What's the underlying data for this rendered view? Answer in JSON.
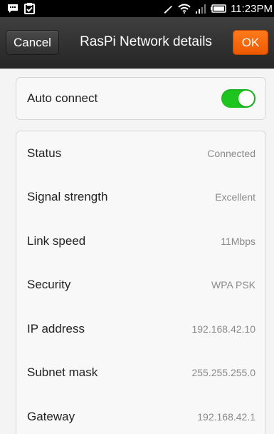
{
  "status_bar": {
    "time": "11:23PM",
    "icons": [
      "chat-bubble-icon",
      "clipboard-check-icon",
      "no-signal-icon",
      "wifi-icon",
      "cell-signal-icon",
      "battery-icon"
    ]
  },
  "action_bar": {
    "cancel_label": "Cancel",
    "title": "RasPi Network details",
    "ok_label": "OK"
  },
  "auto_connect": {
    "label": "Auto connect",
    "enabled": true
  },
  "details": [
    {
      "label": "Status",
      "value": "Connected"
    },
    {
      "label": "Signal strength",
      "value": "Excellent"
    },
    {
      "label": "Link speed",
      "value": "11Mbps"
    },
    {
      "label": "Security",
      "value": "WPA PSK"
    },
    {
      "label": "IP address",
      "value": "192.168.42.10"
    },
    {
      "label": "Subnet mask",
      "value": "255.255.255.0"
    },
    {
      "label": "Gateway",
      "value": "192.168.42.1"
    }
  ],
  "colors": {
    "toggle_on": "#1ec51e",
    "ok_button": "#f26a0f",
    "action_bar": "#333333"
  }
}
